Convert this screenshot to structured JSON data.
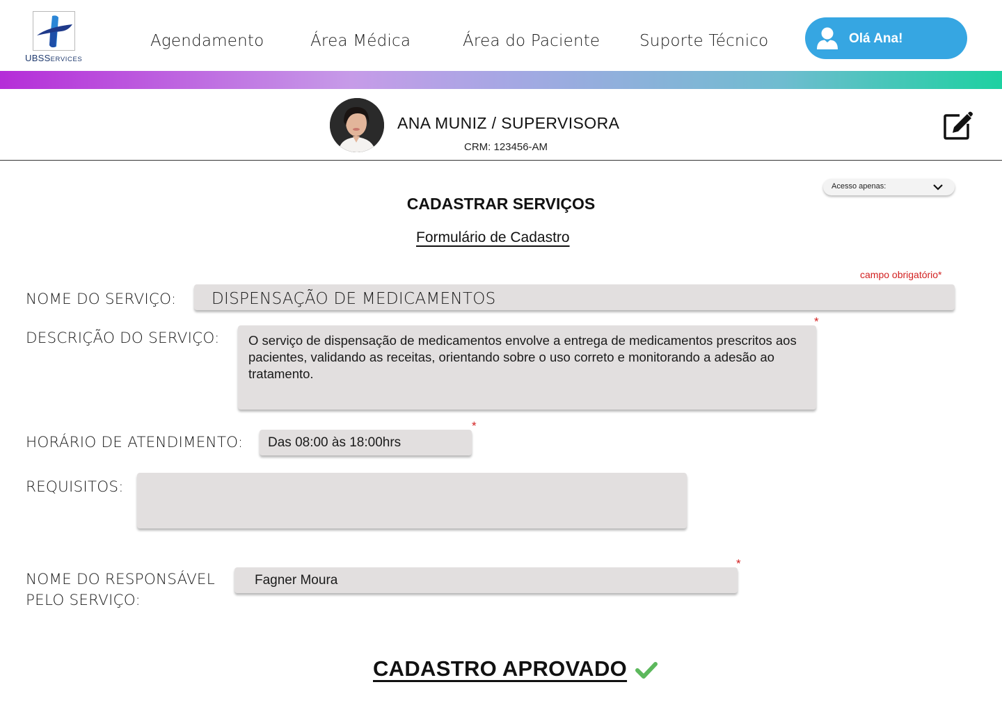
{
  "header": {
    "logo": {
      "text_main": "UBS",
      "text_small": "ERVICES",
      "letter_s": "S"
    },
    "nav": [
      {
        "label": "Agendamento"
      },
      {
        "label": "Área Médica"
      },
      {
        "label": "Área do Paciente"
      },
      {
        "label": "Suporte Técnico"
      }
    ],
    "user_button": {
      "label": "Olá Ana!",
      "icon": "user-icon"
    }
  },
  "profile": {
    "name": "ANA MUNIZ / SUPERVISORA",
    "crm": "CRM: 123456-AM",
    "edit_icon": "edit-icon"
  },
  "access_dropdown": {
    "label": "Acesso apenas:",
    "icon": "chevron-down-icon"
  },
  "page": {
    "title": "CADASTRAR SERVIÇOS",
    "subtitle": "Formulário de Cadastro",
    "required_note": "campo obrigatório*"
  },
  "form": {
    "service_name": {
      "label": "NOME DO SERVIÇO:",
      "value": "DISPENSAÇÃO DE MEDICAMENTOS"
    },
    "description": {
      "label": "DESCRIÇÃO DO SERVIÇO:",
      "value": "O serviço de dispensação de medicamentos envolve a entrega de  medicamentos prescritos aos pacientes, validando as receitas, orientando sobre o uso correto e monitorando a adesão ao tratamento.",
      "required_mark": "*"
    },
    "hours": {
      "label": "HORÁRIO DE ATENDIMENTO:",
      "value": "Das 08:00 às 18:00hrs",
      "required_mark": "*"
    },
    "requirements": {
      "label": "REQUISITOS:",
      "value": ""
    },
    "responsible": {
      "label_line1": "NOME DO RESPONSÁVEL",
      "label_line2": "PELO SERVIÇO:",
      "value": "Fagner Moura",
      "required_mark": "*"
    }
  },
  "status": {
    "label": "CADASTRO APROVADO",
    "icon": "check-icon",
    "icon_color": "#5cb85c"
  },
  "colors": {
    "user_button": "#36a6e2",
    "required": "#d21f1f",
    "field_bg": "#e2dfdf",
    "gradient_start": "#b52dd8",
    "gradient_end": "#1dd1a1"
  }
}
